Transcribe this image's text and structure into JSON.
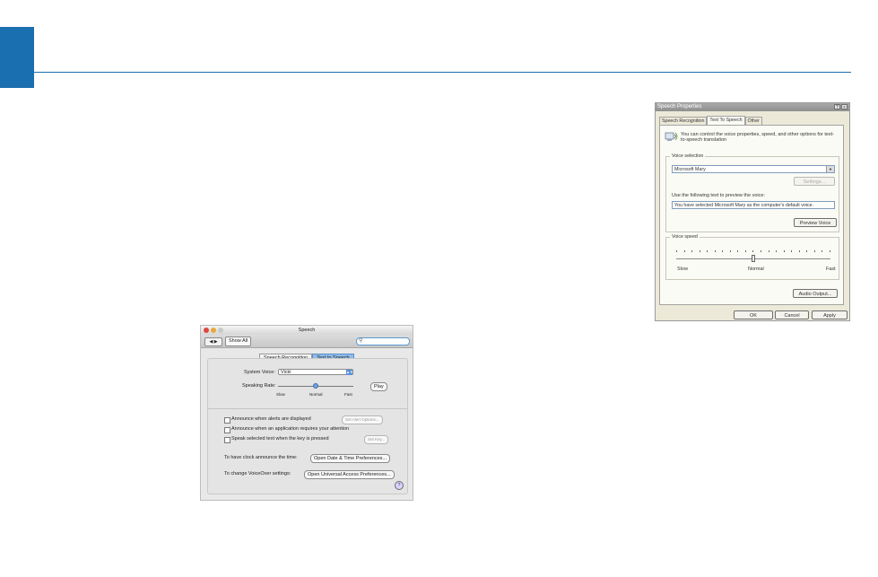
{
  "mac": {
    "window_title": "Speech",
    "nav_label": "◀ ▶",
    "show_all": "Show All",
    "search_placeholder": "",
    "tabs": [
      "Speech Recognition",
      "Text to Speech"
    ],
    "system_voice_label": "System Voice:",
    "system_voice_value": "Vicki",
    "speaking_rate_label": "Speaking Rate:",
    "rate_value": 0.5,
    "rate_ticks": [
      "Slow",
      "Normal",
      "Fast"
    ],
    "play": "Play",
    "checkboxes": [
      "Announce when alerts are displayed",
      "Announce when an application requires your attention",
      "Speak selected text when the key is pressed"
    ],
    "set_alert_options": "Set Alert Options...",
    "set_key": "Set Key...",
    "clock_label": "To have clock announce the time:",
    "clock_button": "Open Date & Time Preferences...",
    "voiceover_label": "To change VoiceOver settings:",
    "voiceover_button": "Open Universal Access Preferences...",
    "help": "?"
  },
  "win": {
    "title": "Speech Properties",
    "title_buttons": [
      "?",
      "×"
    ],
    "tabs": [
      "Speech Recognition",
      "Text To Speech",
      "Other"
    ],
    "intro": "You can control the voice properties, speed, and other options for text-to-speech translation",
    "voice_selection_label": "Voice selection",
    "voice_value": "Microsoft Mary",
    "settings_button": "Settings...",
    "preview_label": "Use the following text to preview the voice:",
    "preview_text": "You have selected Microsoft Mary as the computer's default voice.",
    "preview_button": "Preview Voice",
    "voice_speed_label": "Voice speed",
    "speed_value": 0.5,
    "speed_labels": [
      "Slow",
      "Normal",
      "Fast"
    ],
    "audio_output": "Audio Output...",
    "ok": "OK",
    "cancel": "Cancel",
    "apply": "Apply"
  }
}
